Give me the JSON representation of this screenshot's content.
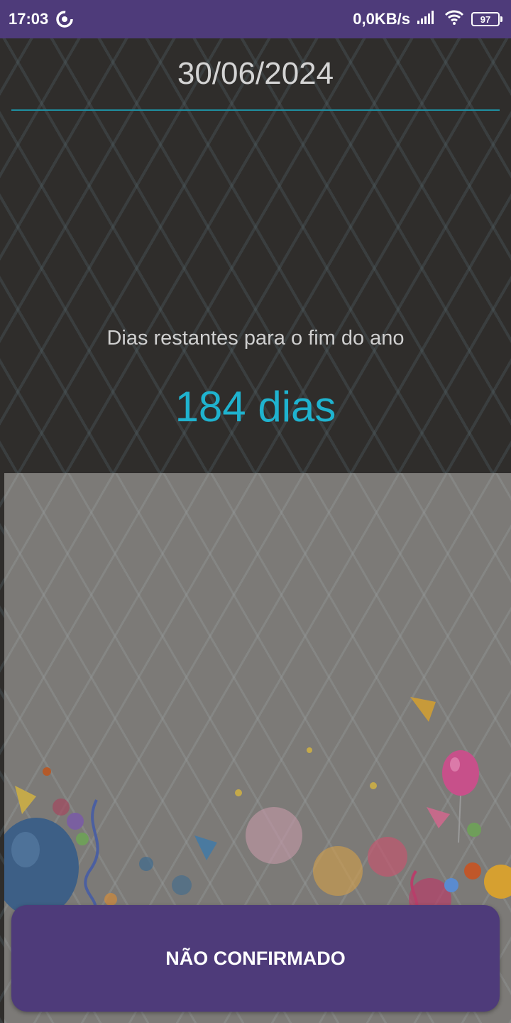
{
  "status_bar": {
    "time": "17:03",
    "network_speed": "0,0KB/s",
    "battery_level": "97",
    "icons": [
      "sync-icon",
      "signal-icon",
      "wifi-icon",
      "battery-icon"
    ]
  },
  "date_field": {
    "value": "30/06/2024"
  },
  "countdown": {
    "label": "Dias restantes para o fim do ano",
    "value": "184 dias"
  },
  "image_panel": {
    "description_icon": "party-balloons-illustration"
  },
  "confirm_button": {
    "label": "NÃO CONFIRMADO"
  },
  "colors": {
    "accent": "#4e3b7a",
    "days_text": "#1fb3cf",
    "underline": "#1f8ea0",
    "background": "#2f2d2b"
  }
}
